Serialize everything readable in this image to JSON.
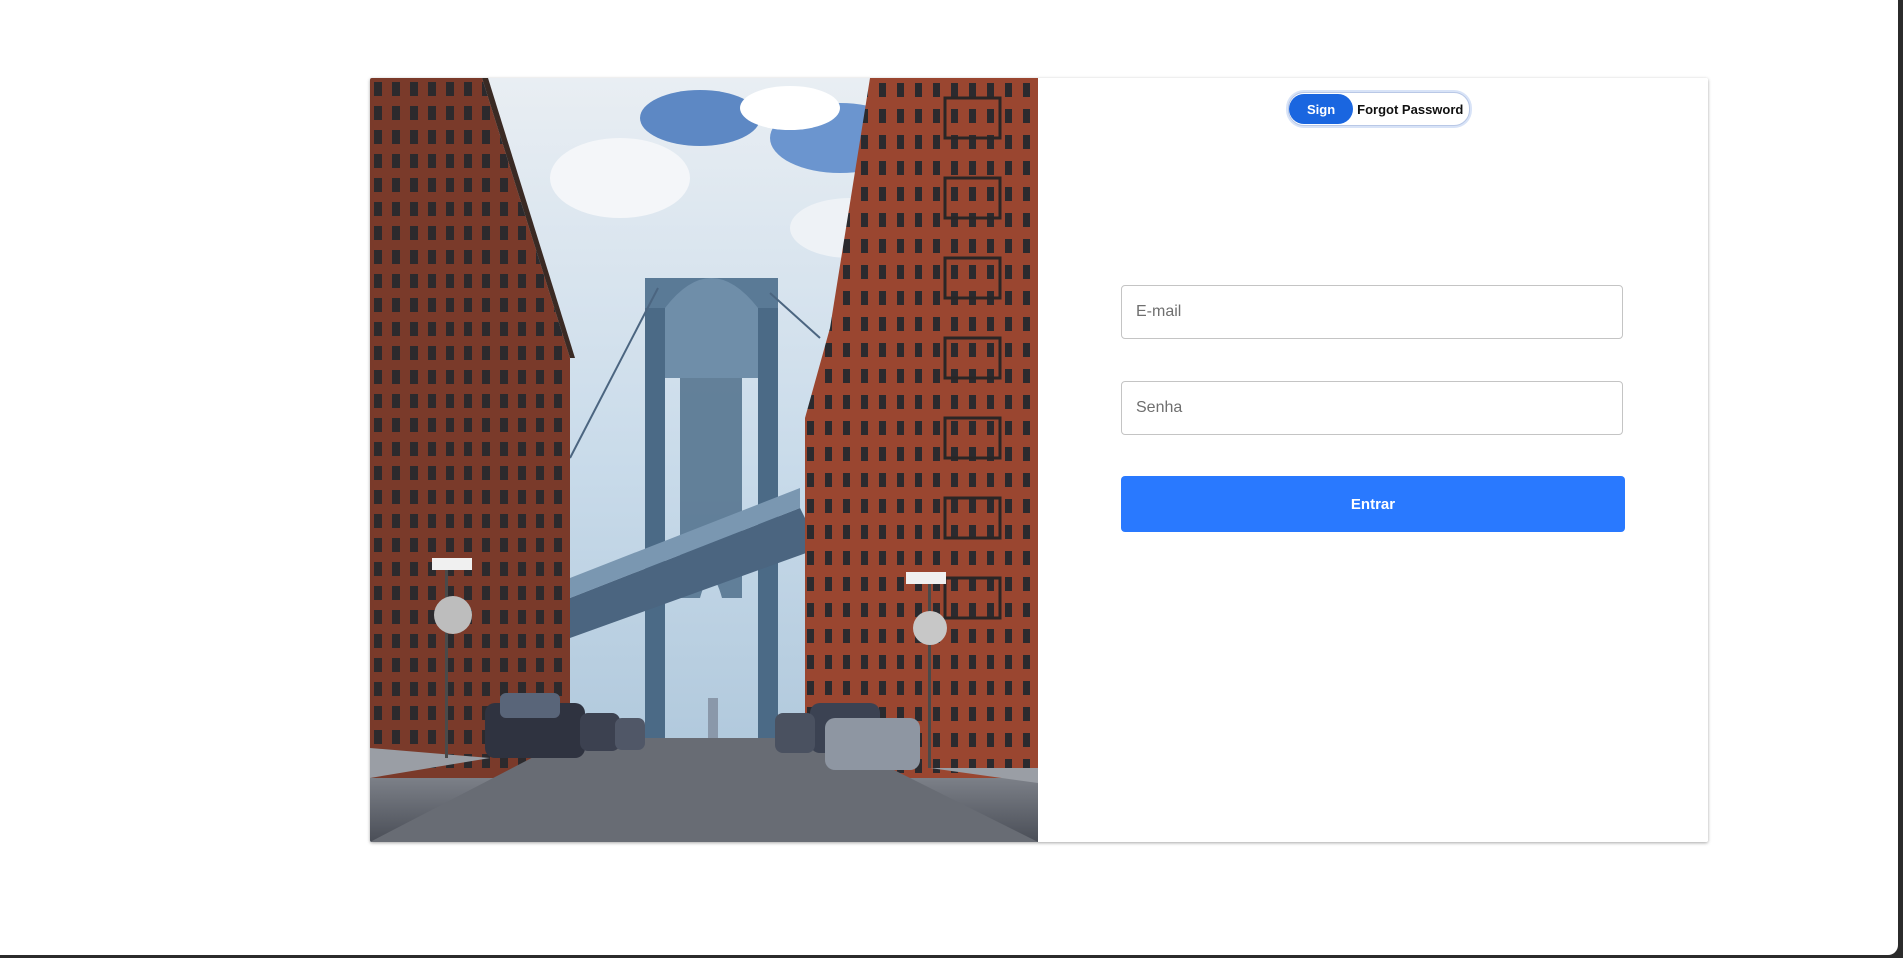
{
  "toggle": {
    "sign_label": "Sign",
    "forgot_label": "Forgot Password"
  },
  "form": {
    "email_placeholder": "E-mail",
    "password_placeholder": "Senha",
    "submit_label": "Entrar"
  },
  "colors": {
    "primary": "#2979ff",
    "toggle_active": "#1a66e0"
  },
  "image": {
    "subject": "city-street-bridge-photo"
  }
}
